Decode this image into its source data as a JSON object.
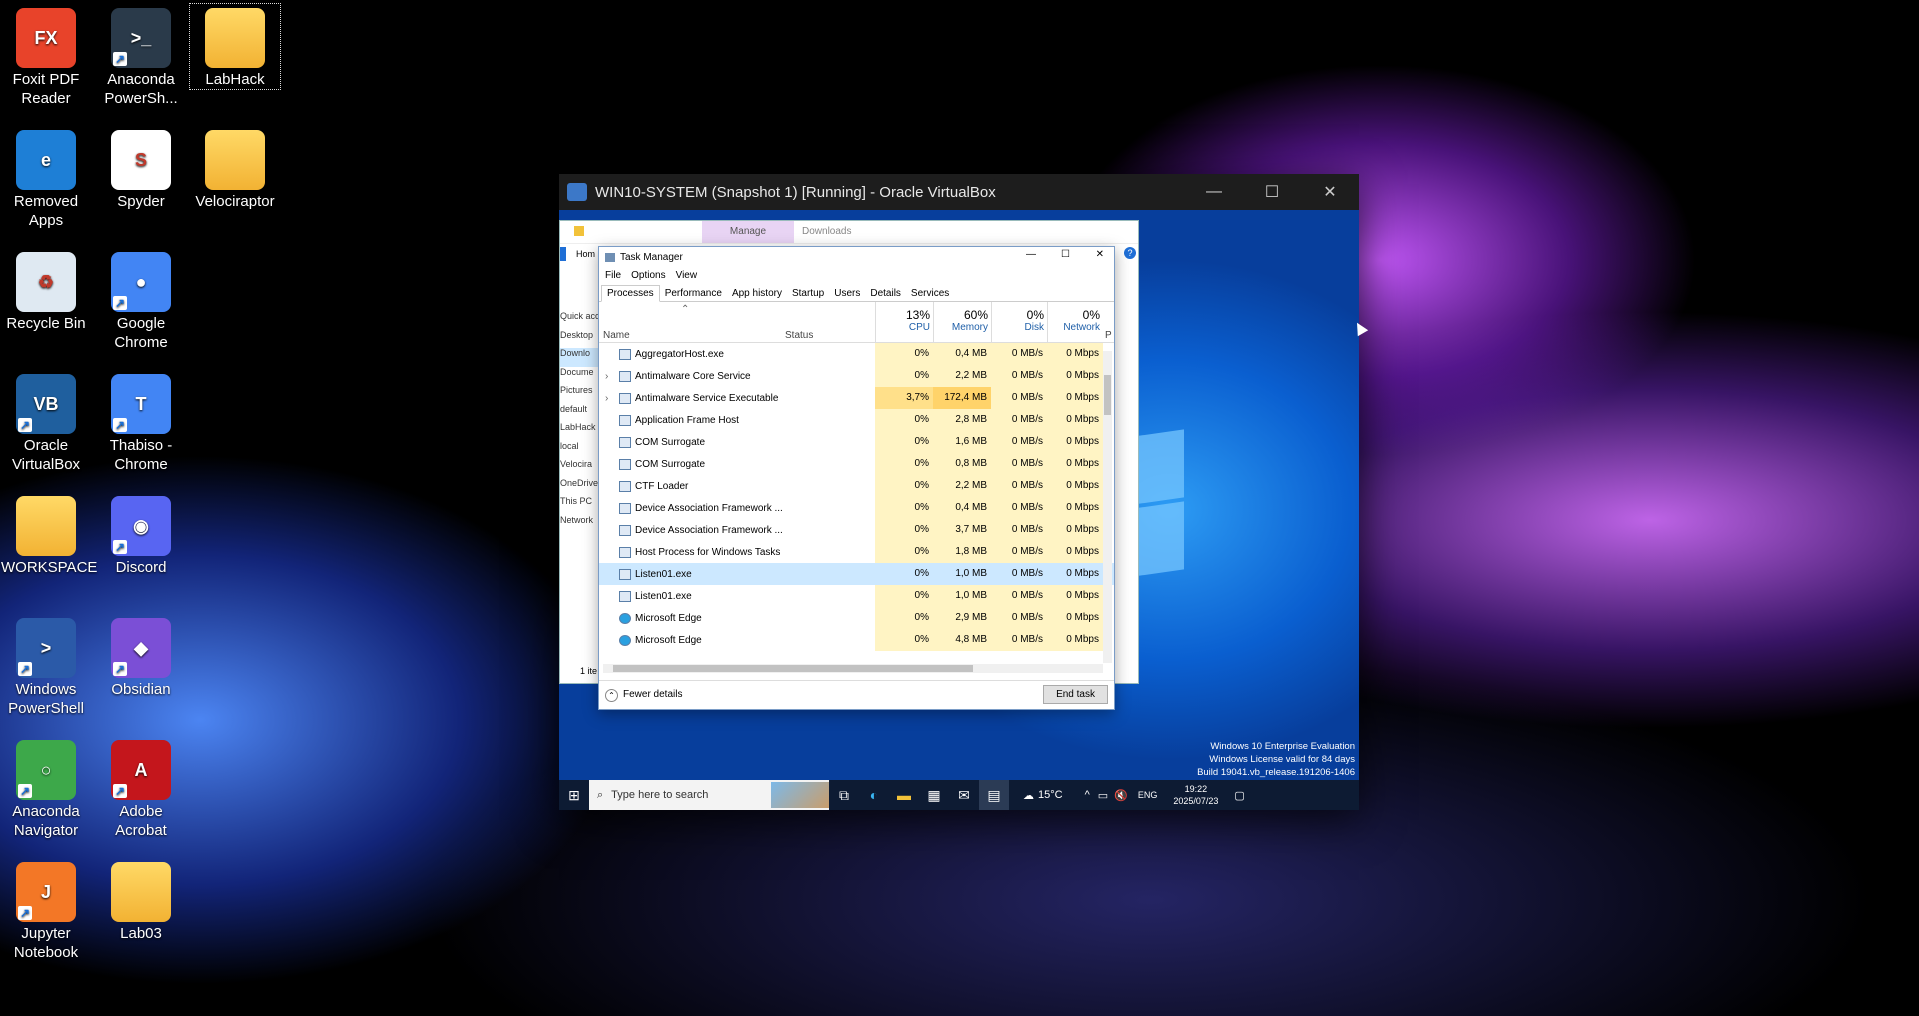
{
  "desktop": {
    "icons": [
      {
        "label": "Foxit PDF Reader",
        "color": "#e8432a",
        "glyph": "FX"
      },
      {
        "label": "Anaconda PowerSh...",
        "color": "#2a3a4a",
        "glyph": ">_"
      },
      {
        "label": "LabHack",
        "color": "#f2b233",
        "glyph": ""
      },
      {
        "label": "Removed Apps",
        "color": "#1e7fd6",
        "glyph": "e"
      },
      {
        "label": "Spyder",
        "color": "#ffffff",
        "glyph": "S"
      },
      {
        "label": "Velociraptor",
        "color": "#f2b233",
        "glyph": ""
      },
      {
        "label": "Recycle Bin",
        "color": "#dfe9f2",
        "glyph": "♻"
      },
      {
        "label": "Google Chrome",
        "color": "#4285f4",
        "glyph": "●"
      },
      {
        "label": "Oracle VirtualBox",
        "color": "#1f5f9e",
        "glyph": "VB"
      },
      {
        "label": "Thabiso - Chrome",
        "color": "#4285f4",
        "glyph": "T"
      },
      {
        "label": "WORKSPACE",
        "color": "#f2c23a",
        "glyph": ""
      },
      {
        "label": "Discord",
        "color": "#5865f2",
        "glyph": "◉"
      },
      {
        "label": "Windows PowerShell",
        "color": "#2b5aa8",
        "glyph": ">"
      },
      {
        "label": "Obsidian",
        "color": "#7b4fd6",
        "glyph": "◆"
      },
      {
        "label": "Anaconda Navigator",
        "color": "#3da84a",
        "glyph": "○"
      },
      {
        "label": "Adobe Acrobat",
        "color": "#c4161c",
        "glyph": "A"
      },
      {
        "label": "Jupyter Notebook",
        "color": "#f37726",
        "glyph": "J"
      },
      {
        "label": "Lab03",
        "color": "#f2c23a",
        "glyph": ""
      }
    ]
  },
  "vbox": {
    "title": "WIN10-SYSTEM (Snapshot 1) [Running] - Oracle VirtualBox",
    "minimize": "—",
    "maximize": "☐",
    "close": "✕"
  },
  "explorer": {
    "ribbon_manage": "Manage",
    "ribbon_downloads": "Downloads",
    "home_tab": "Hom",
    "nav": [
      "Quick acc",
      "Desktop",
      "Downlo",
      "Docume",
      "Pictures",
      "default",
      "LabHack",
      "local",
      "Velocira",
      "OneDrive",
      "This PC",
      "Network"
    ],
    "status": "1 ite"
  },
  "taskmgr": {
    "title": "Task Manager",
    "menu": [
      "File",
      "Options",
      "View"
    ],
    "tabs": [
      "Processes",
      "Performance",
      "App history",
      "Startup",
      "Users",
      "Details",
      "Services"
    ],
    "header": {
      "name": "Name",
      "status": "Status",
      "cpu_pct": "13%",
      "cpu": "CPU",
      "mem_pct": "60%",
      "mem": "Memory",
      "disk_pct": "0%",
      "disk": "Disk",
      "net_pct": "0%",
      "net": "Network",
      "extra": "P"
    },
    "rows": [
      {
        "name": "AggregatorHost.exe",
        "cpu": "0%",
        "mem": "0,4 MB",
        "disk": "0 MB/s",
        "net": "0 Mbps",
        "expand": false
      },
      {
        "name": "Antimalware Core Service",
        "cpu": "0%",
        "mem": "2,2 MB",
        "disk": "0 MB/s",
        "net": "0 Mbps",
        "expand": true
      },
      {
        "name": "Antimalware Service Executable",
        "cpu": "3,7%",
        "mem": "172,4 MB",
        "disk": "0 MB/s",
        "net": "0 Mbps",
        "expand": true
      },
      {
        "name": "Application Frame Host",
        "cpu": "0%",
        "mem": "2,8 MB",
        "disk": "0 MB/s",
        "net": "0 Mbps",
        "expand": false
      },
      {
        "name": "COM Surrogate",
        "cpu": "0%",
        "mem": "1,6 MB",
        "disk": "0 MB/s",
        "net": "0 Mbps",
        "expand": false
      },
      {
        "name": "COM Surrogate",
        "cpu": "0%",
        "mem": "0,8 MB",
        "disk": "0 MB/s",
        "net": "0 Mbps",
        "expand": false
      },
      {
        "name": "CTF Loader",
        "cpu": "0%",
        "mem": "2,2 MB",
        "disk": "0 MB/s",
        "net": "0 Mbps",
        "expand": false
      },
      {
        "name": "Device Association Framework ...",
        "cpu": "0%",
        "mem": "0,4 MB",
        "disk": "0 MB/s",
        "net": "0 Mbps",
        "expand": false
      },
      {
        "name": "Device Association Framework ...",
        "cpu": "0%",
        "mem": "3,7 MB",
        "disk": "0 MB/s",
        "net": "0 Mbps",
        "expand": false
      },
      {
        "name": "Host Process for Windows Tasks",
        "cpu": "0%",
        "mem": "1,8 MB",
        "disk": "0 MB/s",
        "net": "0 Mbps",
        "expand": false
      },
      {
        "name": "Listen01.exe",
        "cpu": "0%",
        "mem": "1,0 MB",
        "disk": "0 MB/s",
        "net": "0 Mbps",
        "expand": false
      },
      {
        "name": "Listen01.exe",
        "cpu": "0%",
        "mem": "1,0 MB",
        "disk": "0 MB/s",
        "net": "0 Mbps",
        "expand": false
      },
      {
        "name": "Microsoft Edge",
        "cpu": "0%",
        "mem": "2,9 MB",
        "disk": "0 MB/s",
        "net": "0 Mbps",
        "expand": false
      },
      {
        "name": "Microsoft Edge",
        "cpu": "0%",
        "mem": "4,8 MB",
        "disk": "0 MB/s",
        "net": "0 Mbps",
        "expand": false
      }
    ],
    "fewer_details": "Fewer details",
    "end_task": "End task"
  },
  "watermark": {
    "line1": "Windows 10 Enterprise Evaluation",
    "line2": "Windows License valid for 84 days",
    "line3": "Build 19041.vb_release.191206-1406"
  },
  "taskbar": {
    "search_placeholder": "Type here to search",
    "weather": "15°C",
    "lang": "ENG",
    "time": "19:22",
    "date": "2025/07/23"
  }
}
